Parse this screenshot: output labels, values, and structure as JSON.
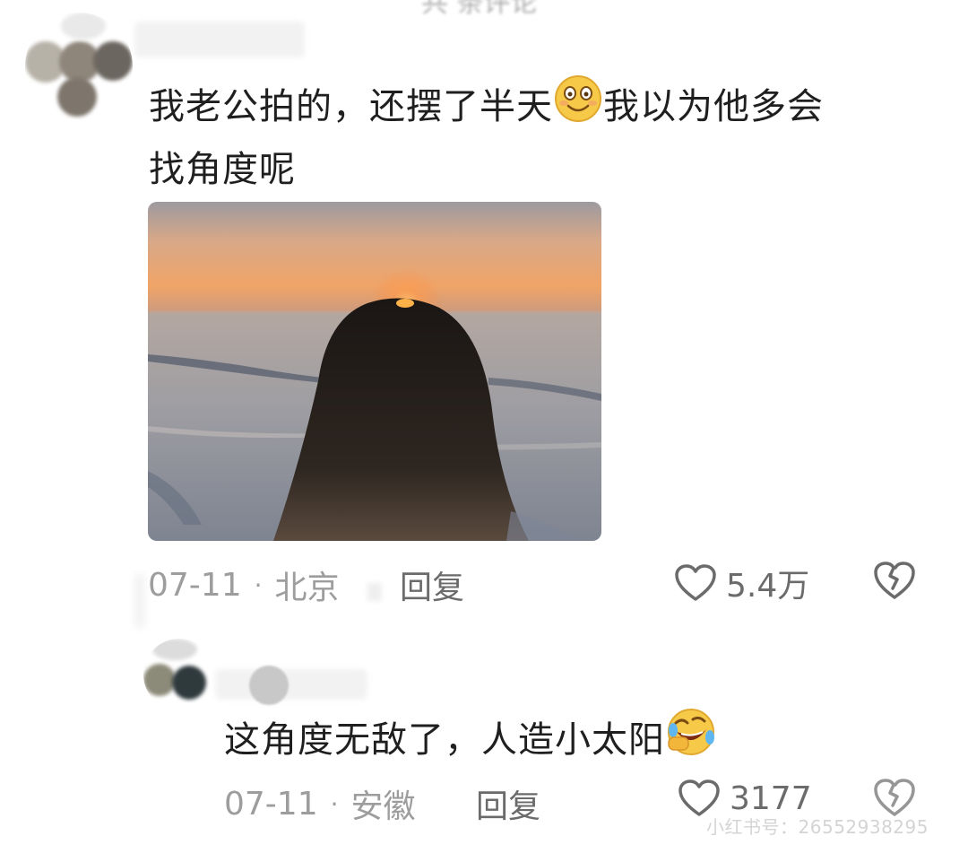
{
  "header": {
    "cutoff_text": "共 条评论"
  },
  "comments": [
    {
      "text_line_1_part_1": "我老公拍的，还摆了半天",
      "text_line_1_part_2": "我以为他多会",
      "text_line_2": "找角度呢",
      "emoji_icon": "smiling-face-icon",
      "date": "07-11",
      "separator": "·",
      "location": "北京",
      "reply_label": "回复",
      "like_count": "5.4万",
      "like_icon": "heart-outline-icon",
      "dislike_icon": "broken-heart-icon"
    },
    {
      "text_part_1": "这角度无敌了，人造小太阳",
      "emoji_icon": "rolling-laughing-face-icon",
      "date": "07-11",
      "separator": "·",
      "location": "安徽",
      "reply_label": "回复",
      "like_count": "3177",
      "like_icon": "heart-outline-icon",
      "dislike_icon": "broken-heart-icon"
    }
  ],
  "watermark": "小红书号：26552938295",
  "colors": {
    "meta_gray": "#9d9d9d",
    "action_gray": "#6b6b6b",
    "text_dark": "#1f1f1f",
    "emoji_yellow": "#f7c948"
  }
}
